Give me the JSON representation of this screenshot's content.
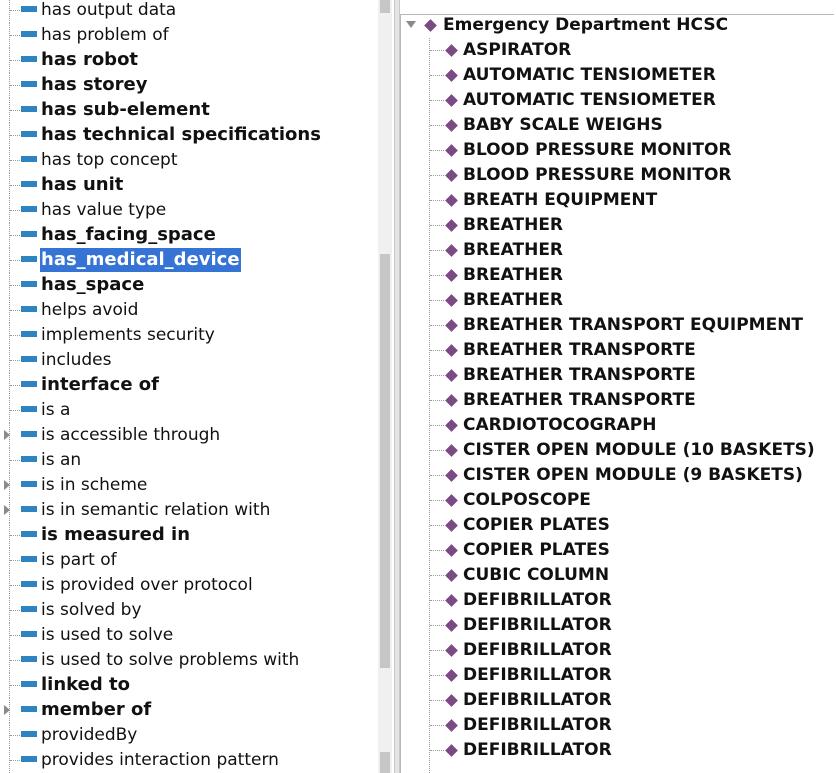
{
  "object_properties": {
    "items": [
      {
        "label": "has output data",
        "bold": false
      },
      {
        "label": "has problem of",
        "bold": false
      },
      {
        "label": "has robot",
        "bold": true
      },
      {
        "label": "has storey",
        "bold": true
      },
      {
        "label": "has sub-element",
        "bold": true
      },
      {
        "label": "has technical specifications",
        "bold": true
      },
      {
        "label": "has top concept",
        "bold": false
      },
      {
        "label": "has unit",
        "bold": true
      },
      {
        "label": "has value type",
        "bold": false
      },
      {
        "label": "has_facing_space",
        "bold": true
      },
      {
        "label": "has_medical_device",
        "bold": true,
        "selected": true
      },
      {
        "label": "has_space",
        "bold": true
      },
      {
        "label": "helps avoid",
        "bold": false
      },
      {
        "label": "implements security",
        "bold": false
      },
      {
        "label": "includes",
        "bold": false
      },
      {
        "label": "interface of",
        "bold": true
      },
      {
        "label": "is a",
        "bold": false
      },
      {
        "label": "is accessible through",
        "bold": false,
        "expandable": true
      },
      {
        "label": "is an",
        "bold": false
      },
      {
        "label": "is in scheme",
        "bold": false,
        "expandable": true
      },
      {
        "label": "is in semantic relation with",
        "bold": false,
        "expandable": true
      },
      {
        "label": "is measured in",
        "bold": true
      },
      {
        "label": "is part of",
        "bold": false
      },
      {
        "label": "is provided over protocol",
        "bold": false
      },
      {
        "label": "is solved by",
        "bold": false
      },
      {
        "label": "is used to solve",
        "bold": false
      },
      {
        "label": "is used to solve problems with",
        "bold": false
      },
      {
        "label": "linked to",
        "bold": true
      },
      {
        "label": "member of",
        "bold": true,
        "expandable": true
      },
      {
        "label": "providedBy",
        "bold": false
      },
      {
        "label": "provides interaction pattern",
        "bold": false
      }
    ]
  },
  "individuals": {
    "root": "Emergency Department HCSC",
    "items": [
      "ASPIRATOR",
      "AUTOMATIC TENSIOMETER",
      "AUTOMATIC TENSIOMETER",
      "BABY SCALE WEIGHS",
      "BLOOD PRESSURE MONITOR",
      "BLOOD PRESSURE MONITOR",
      "BREATH EQUIPMENT",
      "BREATHER",
      "BREATHER",
      "BREATHER",
      "BREATHER",
      "BREATHER TRANSPORT EQUIPMENT",
      "BREATHER TRANSPORTE",
      "BREATHER TRANSPORTE",
      "BREATHER TRANSPORTE",
      "CARDIOTOCOGRAPH",
      "CISTER OPEN MODULE (10 BASKETS)",
      "CISTER OPEN MODULE (9 BASKETS)",
      "COLPOSCOPE",
      "COPIER PLATES",
      "COPIER PLATES",
      "CUBIC COLUMN",
      "DEFIBRILLATOR",
      "DEFIBRILLATOR",
      "DEFIBRILLATOR",
      "DEFIBRILLATOR",
      "DEFIBRILLATOR",
      "DEFIBRILLATOR",
      "DEFIBRILLATOR"
    ]
  },
  "colors": {
    "selection": "#3574d4",
    "property_icon": "#2e83c0",
    "individual_icon": "#7a4a82"
  },
  "icons": {
    "property": "object-property-icon",
    "individual": "individual-diamond-icon",
    "expander": "triangle-right-icon",
    "collapse": "triangle-down-icon"
  }
}
